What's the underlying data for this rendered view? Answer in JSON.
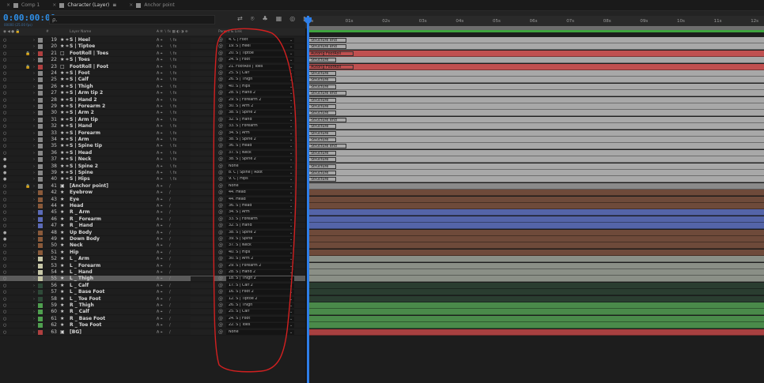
{
  "tabs": [
    {
      "label": "Comp 1",
      "color": "#8e8e8e"
    },
    {
      "label": "Character (Layer)",
      "color": "#8e8e8e",
      "active": true
    },
    {
      "label": "Anchor point",
      "color": "#8e8e8e"
    }
  ],
  "header": {
    "timecode": "0:00:00:00",
    "fps": "00000 (25.00 fps)",
    "search_placeholder": "ρ.",
    "menu_glyph": "≡",
    "tab_close": "×"
  },
  "ruler": {
    "ticks": [
      "0s",
      "01s",
      "02s",
      "03s",
      "04s",
      "05s",
      "06s",
      "07s",
      "08s",
      "09s",
      "10s",
      "11s",
      "12s"
    ]
  },
  "columns": {
    "hash": "#",
    "name": "Layer Name",
    "parent": "Parent & Link"
  },
  "layers": [
    {
      "num": "19",
      "name": "S | Heel",
      "type": "shape",
      "label": "#888888",
      "parent": "4. C | Foot",
      "clip": "Structure end",
      "bar": "#a8a8a8"
    },
    {
      "num": "20",
      "name": "S | Tiptoe",
      "type": "shape",
      "label": "#888888",
      "parent": "19. S | Heel",
      "clip": "Structure end",
      "bar": "#a8a8a8"
    },
    {
      "num": "21",
      "name": "FootRoll | Toes",
      "type": "solid",
      "label": "#b04040",
      "locked": true,
      "parent": "20. S | Tiptoe",
      "clip": "Autorig FootRoll",
      "bar": "#c05050",
      "bold": true
    },
    {
      "num": "22",
      "name": "S | Toes",
      "type": "shape",
      "label": "#888888",
      "parent": "24. S | Foot",
      "clip": "Structure",
      "bar": "#a8a8a8"
    },
    {
      "num": "23",
      "name": "FootRoll | Foot",
      "type": "solid",
      "label": "#b04040",
      "locked": true,
      "parent": "21. FootRoll | Toes",
      "clip": "Autorig FootRoll",
      "bar": "#c05050",
      "bold": true
    },
    {
      "num": "24",
      "name": "S | Foot",
      "type": "shape",
      "label": "#888888",
      "parent": "25. S | Calf",
      "clip": "Structure",
      "bar": "#a8a8a8"
    },
    {
      "num": "25",
      "name": "S | Calf",
      "type": "shape",
      "label": "#888888",
      "parent": "26. S | Thigh",
      "clip": "Structure",
      "bar": "#a8a8a8"
    },
    {
      "num": "26",
      "name": "S | Thigh",
      "type": "shape",
      "label": "#888888",
      "parent": "40. S | Hips",
      "clip": "Structure",
      "bar": "#a8a8a8"
    },
    {
      "num": "27",
      "name": "S | Arm tip 2",
      "type": "shape",
      "label": "#888888",
      "parent": "28. S | Hand 2",
      "clip": "Structure end",
      "bar": "#a8a8a8"
    },
    {
      "num": "28",
      "name": "S | Hand 2",
      "type": "shape",
      "label": "#888888",
      "parent": "29. S | Forearm 2",
      "clip": "Structure",
      "bar": "#a8a8a8"
    },
    {
      "num": "29",
      "name": "S | Forearm 2",
      "type": "shape",
      "label": "#888888",
      "parent": "30. S | Arm 2",
      "clip": "Structure",
      "bar": "#a8a8a8"
    },
    {
      "num": "30",
      "name": "S | Arm 2",
      "type": "shape",
      "label": "#888888",
      "parent": "38. S | Spine 2",
      "clip": "Structure",
      "bar": "#a8a8a8"
    },
    {
      "num": "31",
      "name": "S | Arm tip",
      "type": "shape",
      "label": "#888888",
      "parent": "32. S | Hand",
      "clip": "Structure end",
      "bar": "#a8a8a8"
    },
    {
      "num": "32",
      "name": "S | Hand",
      "type": "shape",
      "label": "#888888",
      "parent": "33. S | Forearm",
      "clip": "Structure",
      "bar": "#a8a8a8"
    },
    {
      "num": "33",
      "name": "S | Forearm",
      "type": "shape",
      "label": "#888888",
      "parent": "34. S | Arm",
      "clip": "Structure",
      "bar": "#a8a8a8"
    },
    {
      "num": "34",
      "name": "S | Arm",
      "type": "shape",
      "label": "#888888",
      "parent": "38. S | Spine 2",
      "clip": "Structure",
      "bar": "#a8a8a8"
    },
    {
      "num": "35",
      "name": "S | Spine tip",
      "type": "shape",
      "label": "#888888",
      "parent": "36. S | Head",
      "clip": "Structure end",
      "bar": "#a8a8a8"
    },
    {
      "num": "36",
      "name": "S | Head",
      "type": "shape",
      "label": "#888888",
      "parent": "37. S | Neck",
      "clip": "Structure",
      "bar": "#a8a8a8"
    },
    {
      "num": "37",
      "name": "S | Neck",
      "type": "shape",
      "label": "#888888",
      "eye": true,
      "parent": "38. S | Spine 2",
      "clip": "Structure",
      "bar": "#a8a8a8"
    },
    {
      "num": "38",
      "name": "S | Spine 2",
      "type": "shape",
      "label": "#888888",
      "eye": true,
      "parent": "None",
      "clip": "Structure",
      "bar": "#a8a8a8"
    },
    {
      "num": "39",
      "name": "S | Spine",
      "type": "shape",
      "label": "#888888",
      "eye": true,
      "parent": "8. C | Spine | Root",
      "clip": "Structure",
      "bar": "#a8a8a8"
    },
    {
      "num": "40",
      "name": "S | Hips",
      "type": "shape",
      "label": "#888888",
      "eye": true,
      "parent": "9. C | Hips",
      "clip": "Structure",
      "bar": "#a8a8a8"
    },
    {
      "num": "41",
      "name": "[Anchor point]",
      "type": "comp",
      "label": "#888888",
      "locked": true,
      "parent": "None",
      "clip": "",
      "bar": "#8a8a8a"
    },
    {
      "num": "42",
      "name": "Eyebrow",
      "type": "star",
      "label": "#8a5a3a",
      "parent": "44. Head",
      "clip": "",
      "bar": "#6e4a3a"
    },
    {
      "num": "43",
      "name": "Eye",
      "type": "star",
      "label": "#8a5a3a",
      "parent": "44. Head",
      "clip": "",
      "bar": "#6e4a3a"
    },
    {
      "num": "44",
      "name": "Head",
      "type": "star",
      "label": "#8a5a3a",
      "parent": "36. S | Head",
      "clip": "",
      "bar": "#6e4a3a"
    },
    {
      "num": "45",
      "name": "R _ Arm",
      "type": "star",
      "label": "#5b6bb8",
      "parent": "34. S | Arm",
      "clip": "",
      "bar": "#5464a8"
    },
    {
      "num": "46",
      "name": "R _ Forearm",
      "type": "star",
      "label": "#5b6bb8",
      "parent": "33. S | Forearm",
      "clip": "",
      "bar": "#5464a8"
    },
    {
      "num": "47",
      "name": "R _ Hand",
      "type": "star",
      "label": "#5b6bb8",
      "parent": "32. S | Hand",
      "clip": "",
      "bar": "#5464a8"
    },
    {
      "num": "48",
      "name": "Up Body",
      "type": "star",
      "label": "#8a5a3a",
      "eye": true,
      "parent": "38. S | Spine 2",
      "clip": "",
      "bar": "#6e4a3a"
    },
    {
      "num": "49",
      "name": "Down Body",
      "type": "star",
      "label": "#8a5a3a",
      "eye": true,
      "parent": "39. S | Spine",
      "clip": "",
      "bar": "#6e4a3a"
    },
    {
      "num": "50",
      "name": "Neck",
      "type": "star",
      "label": "#8a5a3a",
      "parent": "37. S | Neck",
      "clip": "",
      "bar": "#6e4a3a"
    },
    {
      "num": "51",
      "name": "Hip",
      "type": "star",
      "label": "#8a5a3a",
      "parent": "40. S | Hips",
      "clip": "",
      "bar": "#6e4a3a"
    },
    {
      "num": "52",
      "name": "L _ Arm",
      "type": "star",
      "label": "#c8c8a8",
      "parent": "30. S | Arm 2",
      "clip": "",
      "bar": "#8a8f86"
    },
    {
      "num": "53",
      "name": "L _ Forearm",
      "type": "star",
      "label": "#c8c8a8",
      "parent": "29. S | Forearm 2",
      "clip": "",
      "bar": "#8a8f86"
    },
    {
      "num": "54",
      "name": "L _ Hand",
      "type": "star",
      "label": "#c8c8a8",
      "parent": "28. S | Hand 2",
      "clip": "",
      "bar": "#8a8f86"
    },
    {
      "num": "55",
      "name": "L _ Thigh",
      "type": "star",
      "label": "#c8c8a8",
      "selected": true,
      "parent": "18. S | Thigh 2",
      "clip": "",
      "bar": "#8a8f86"
    },
    {
      "num": "56",
      "name": "L _ Calf",
      "type": "star",
      "label": "#2e4a38",
      "parent": "17. S | Calf 2",
      "clip": "",
      "bar": "#2a3d30"
    },
    {
      "num": "57",
      "name": "L _ Base Foot",
      "type": "star",
      "label": "#2e4a38",
      "parent": "16. S | Foot 2",
      "clip": "",
      "bar": "#2a3d30"
    },
    {
      "num": "58",
      "name": "L _ Toe Foot",
      "type": "star",
      "label": "#2e4a38",
      "parent": "12. S | Tiptoe 2",
      "clip": "",
      "bar": "#2a3d30"
    },
    {
      "num": "59",
      "name": "R _ Thigh",
      "type": "star",
      "label": "#4fa04f",
      "parent": "26. S | Thigh",
      "clip": "",
      "bar": "#4a8a4a"
    },
    {
      "num": "60",
      "name": "R _ Calf",
      "type": "star",
      "label": "#4fa04f",
      "parent": "25. S | Calf",
      "clip": "",
      "bar": "#4a8a4a"
    },
    {
      "num": "61",
      "name": "R _ Base Foot",
      "type": "star",
      "label": "#4fa04f",
      "parent": "24. S | Foot",
      "clip": "",
      "bar": "#4a8a4a"
    },
    {
      "num": "62",
      "name": "R _ Toe Foot",
      "type": "star",
      "label": "#4fa04f",
      "parent": "22. S | Toes",
      "clip": "",
      "bar": "#4a8a4a"
    },
    {
      "num": "63",
      "name": "[BG]",
      "type": "comp",
      "label": "#b04040",
      "parent": "None",
      "clip": "",
      "bar": "#a84040"
    }
  ],
  "annotation_color": "#d22020"
}
